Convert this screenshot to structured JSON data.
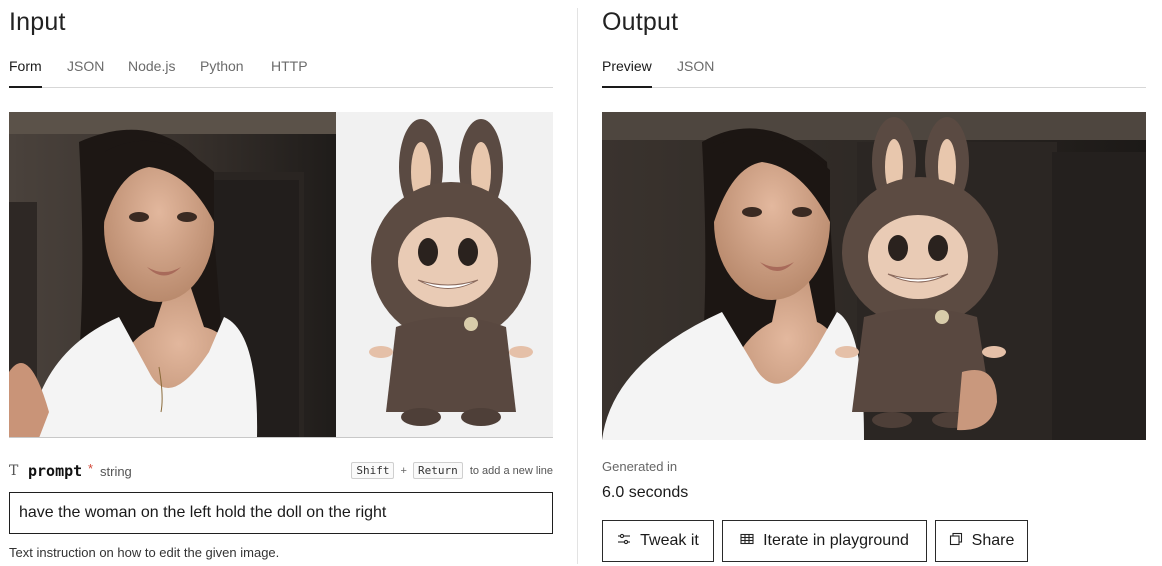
{
  "input": {
    "title": "Input",
    "tabs": [
      "Form",
      "JSON",
      "Node.js",
      "Python",
      "HTTP"
    ],
    "active_tab": "Form",
    "prompt": {
      "type_glyph": "T",
      "name": "prompt",
      "required_mark": "*",
      "type": "string",
      "hint": {
        "key1": "Shift",
        "plus": "+",
        "key2": "Return",
        "tail": "to add a new line"
      },
      "value": "have the woman on the left hold the doll on the right",
      "description": "Text instruction on how to edit the given image."
    }
  },
  "output": {
    "title": "Output",
    "tabs": [
      "Preview",
      "JSON"
    ],
    "active_tab": "Preview",
    "generated_label": "Generated in",
    "generated_value": "6.0 seconds",
    "buttons": {
      "tweak": "Tweak it",
      "iterate": "Iterate in playground",
      "share": "Share"
    }
  },
  "icons": {
    "tweak": "sliders-icon",
    "iterate": "table-grid-icon",
    "share": "copy-icon"
  }
}
